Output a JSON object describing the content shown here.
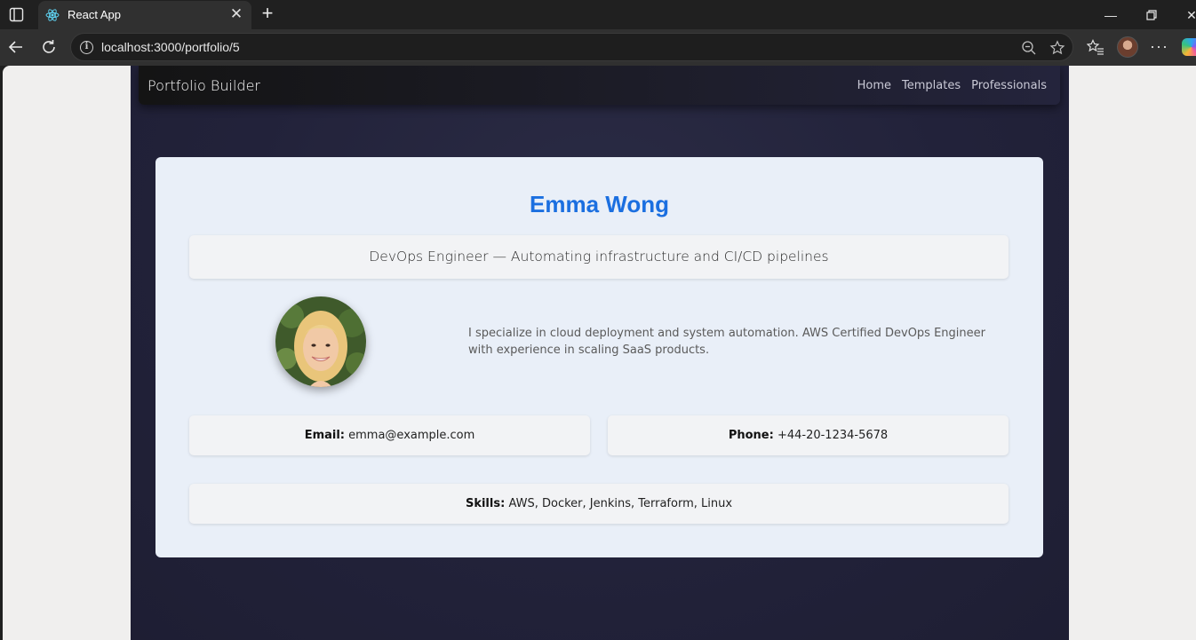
{
  "browser": {
    "tab_title": "React App",
    "url": "localhost:3000/portfolio/5"
  },
  "app": {
    "brand": "Portfolio Builder",
    "nav": [
      "Home",
      "Templates",
      "Professionals"
    ]
  },
  "portfolio": {
    "name": "Emma Wong",
    "headline": "DevOps Engineer — Automating infrastructure and CI/CD pipelines",
    "bio": "I specialize in cloud deployment and system automation. AWS Certified DevOps Engineer with experience in scaling SaaS products.",
    "email_label": "Email:",
    "email": "emma@example.com",
    "phone_label": "Phone:",
    "phone": "+44-20-1234-5678",
    "skills_label": "Skills:",
    "skills": "AWS, Docker, Jenkins, Terraform, Linux"
  },
  "colors": {
    "accent": "#1b6fe0",
    "page_bg": "#22223a",
    "card_bg": "#e9eff8"
  }
}
